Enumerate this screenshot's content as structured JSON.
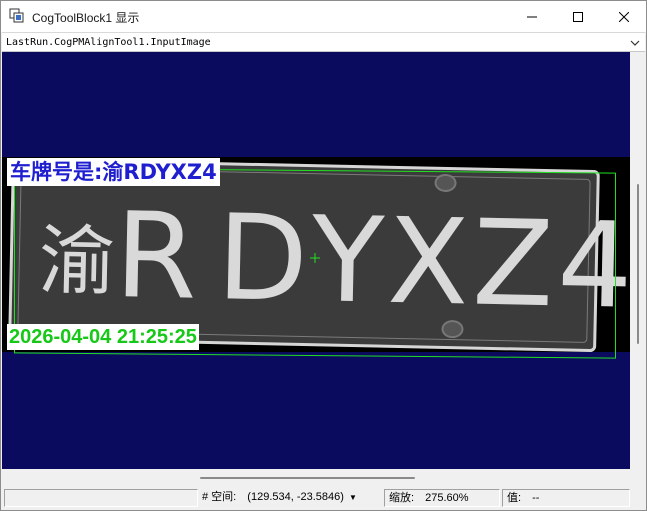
{
  "window": {
    "title": "CogToolBlock1 显示",
    "controls": {
      "minimize": "minimize-icon",
      "maximize": "maximize-icon",
      "close": "close-icon"
    }
  },
  "selector": {
    "value": "LastRun.CogPMAlignTool1.InputImage"
  },
  "image": {
    "plate_label": "车牌号是:渝RDYXZ4",
    "timestamp_label": "2026-04-04 21:25:25",
    "plate_chars": [
      "渝",
      "R",
      "D",
      "Y",
      "X",
      "Z",
      "4"
    ],
    "colors": {
      "background": "#0a0a5e",
      "plate_label_text": "#1f1fd0",
      "timestamp_text": "#18c818",
      "graphics": "#20e020"
    }
  },
  "statusbar": {
    "coord_prefix": "# 空间:",
    "coord_value": "(129.534, -23.5846)",
    "zoom_label": "缩放:",
    "zoom_value": "275.60%",
    "value_label": "值:",
    "value_value": "--"
  }
}
